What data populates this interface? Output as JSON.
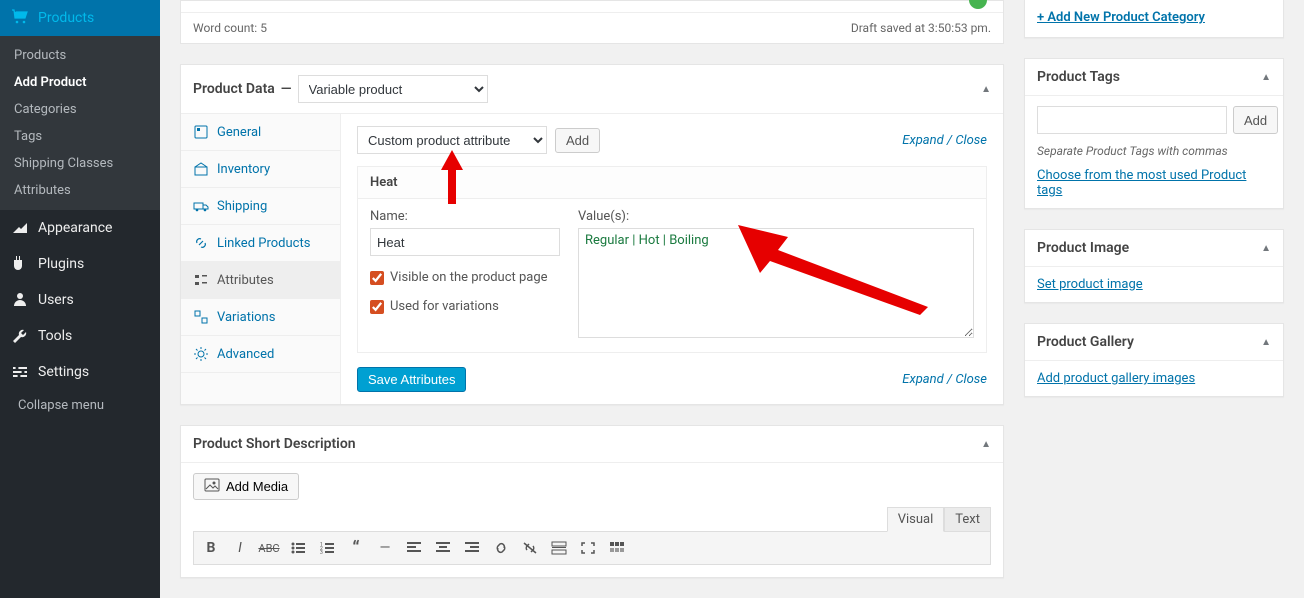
{
  "sidebar": {
    "current": "Products",
    "submenu": [
      {
        "label": "Products",
        "active": false
      },
      {
        "label": "Add Product",
        "active": true
      },
      {
        "label": "Categories",
        "active": false
      },
      {
        "label": "Tags",
        "active": false
      },
      {
        "label": "Shipping Classes",
        "active": false
      },
      {
        "label": "Attributes",
        "active": false
      }
    ],
    "items": [
      {
        "label": "Appearance",
        "icon": "appearance"
      },
      {
        "label": "Plugins",
        "icon": "plugin"
      },
      {
        "label": "Users",
        "icon": "users"
      },
      {
        "label": "Tools",
        "icon": "tools"
      },
      {
        "label": "Settings",
        "icon": "settings"
      }
    ],
    "collapse": "Collapse menu"
  },
  "editor_strip": {
    "word_count_label": "Word count:",
    "word_count": "5",
    "draft_status": "Draft saved at 3:50:53 pm."
  },
  "product_data": {
    "title": "Product Data",
    "dash": "—",
    "type_select": "Variable product",
    "tabs": [
      {
        "label": "General",
        "icon": "general"
      },
      {
        "label": "Inventory",
        "icon": "inventory"
      },
      {
        "label": "Shipping",
        "icon": "shipping"
      },
      {
        "label": "Linked Products",
        "icon": "linked"
      },
      {
        "label": "Attributes",
        "icon": "attributes",
        "active": true
      },
      {
        "label": "Variations",
        "icon": "variations"
      },
      {
        "label": "Advanced",
        "icon": "advanced"
      }
    ],
    "attr_select": "Custom product attribute",
    "add_btn": "Add",
    "expand_close": "Expand / Close",
    "attribute": {
      "title": "Heat",
      "name_label": "Name:",
      "name_value": "Heat",
      "values_label": "Value(s):",
      "values_value": "Regular | Hot | Boiling",
      "visible_label": "Visible on the product page",
      "used_label": "Used for variations"
    },
    "save_btn": "Save Attributes"
  },
  "short_desc": {
    "title": "Product Short Description",
    "add_media": "Add Media",
    "tab_visual": "Visual",
    "tab_text": "Text"
  },
  "right": {
    "add_category_link": "+ Add New Product Category",
    "tags": {
      "title": "Product Tags",
      "add_btn": "Add",
      "hint": "Separate Product Tags with commas",
      "choose_link": "Choose from the most used Product tags"
    },
    "image": {
      "title": "Product Image",
      "link": "Set product image"
    },
    "gallery": {
      "title": "Product Gallery",
      "link": "Add product gallery images"
    }
  }
}
